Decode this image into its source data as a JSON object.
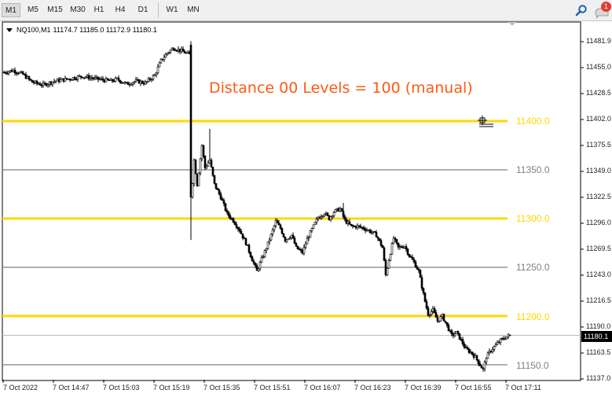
{
  "toolbar": {
    "timeframes": [
      "M1",
      "M5",
      "M15",
      "M30",
      "H1",
      "H4",
      "D1",
      "W1",
      "MN"
    ],
    "active_timeframe": "M1",
    "notification_count": "1"
  },
  "chart": {
    "symbol": "NQ100,M1",
    "ohlc": "11174.7 11185.0 11172.9 11180.1",
    "annotation": "Distance 00 Levels = 100 (manual)",
    "current_price": "11180.1",
    "price_labels": [
      "11481.9",
      "11455.0",
      "11428.5",
      "11402.0",
      "11375.5",
      "11349.0",
      "11322.5",
      "11296.0",
      "11269.5",
      "11243.0",
      "11216.5",
      "11190.0",
      "11163.5",
      "11137.0"
    ],
    "time_labels": [
      "7 Oct 2022",
      "7 Oct 14:47",
      "7 Oct 15:03",
      "7 Oct 15:19",
      "7 Oct 15:35",
      "7 Oct 15:51",
      "7 Oct 16:07",
      "7 Oct 16:23",
      "7 Oct 16:39",
      "7 Oct 16:55",
      "7 Oct 17:11"
    ],
    "levels": [
      {
        "label": "11400.0",
        "price": 11400,
        "color": "#ffd700"
      },
      {
        "label": "11350.0",
        "price": 11350,
        "color": "#808080"
      },
      {
        "label": "11300.0",
        "price": 11300,
        "color": "#ffd700"
      },
      {
        "label": "11250.0",
        "price": 11250,
        "color": "#808080"
      },
      {
        "label": "11200.0",
        "price": 11200,
        "color": "#ffd700"
      },
      {
        "label": "11150.0",
        "price": 11150,
        "color": "#808080"
      }
    ],
    "colors": {
      "major_level": "#ffd700",
      "minor_level": "#808080",
      "annotation": "#ff5a14",
      "candle": "#000000"
    }
  },
  "chart_data": {
    "type": "candlestick",
    "ylim": [
      11137,
      11490
    ],
    "close_path": [
      [
        0,
        11450
      ],
      [
        6,
        11452
      ],
      [
        12,
        11448
      ],
      [
        18,
        11440
      ],
      [
        25,
        11437
      ],
      [
        32,
        11441
      ],
      [
        40,
        11443
      ],
      [
        50,
        11446
      ],
      [
        60,
        11443
      ],
      [
        68,
        11441
      ],
      [
        72,
        11443
      ],
      [
        78,
        11438
      ],
      [
        84,
        11441
      ],
      [
        90,
        11439
      ],
      [
        96,
        11447
      ],
      [
        100,
        11462
      ],
      [
        104,
        11470
      ],
      [
        108,
        11475
      ],
      [
        113,
        11472
      ],
      [
        118,
        11468
      ],
      [
        118.5,
        11325
      ],
      [
        119,
        11315
      ],
      [
        121,
        11360
      ],
      [
        123,
        11335
      ],
      [
        126,
        11375
      ],
      [
        128,
        11352
      ],
      [
        131,
        11360
      ],
      [
        134,
        11335
      ],
      [
        138,
        11322
      ],
      [
        142,
        11305
      ],
      [
        146,
        11298
      ],
      [
        150,
        11288
      ],
      [
        154,
        11275
      ],
      [
        158,
        11258
      ],
      [
        161,
        11246
      ],
      [
        164,
        11258
      ],
      [
        167,
        11270
      ],
      [
        170,
        11283
      ],
      [
        173,
        11297
      ],
      [
        176,
        11290
      ],
      [
        179,
        11278
      ],
      [
        183,
        11283
      ],
      [
        186,
        11270
      ],
      [
        190,
        11265
      ],
      [
        193,
        11279
      ],
      [
        197,
        11292
      ],
      [
        200,
        11301
      ],
      [
        204,
        11306
      ],
      [
        207,
        11300
      ],
      [
        210,
        11307
      ],
      [
        214,
        11310
      ],
      [
        217,
        11298
      ],
      [
        221,
        11292
      ],
      [
        225,
        11292
      ],
      [
        229,
        11290
      ],
      [
        233,
        11287
      ],
      [
        237,
        11283
      ],
      [
        241,
        11270
      ],
      [
        243,
        11242
      ],
      [
        245,
        11258
      ],
      [
        248,
        11280
      ],
      [
        251,
        11270
      ],
      [
        255,
        11272
      ],
      [
        258,
        11262
      ],
      [
        261,
        11255
      ],
      [
        264,
        11246
      ],
      [
        266,
        11230
      ],
      [
        268,
        11215
      ],
      [
        270,
        11202
      ],
      [
        273,
        11206
      ],
      [
        276,
        11195
      ],
      [
        279,
        11200
      ],
      [
        282,
        11190
      ],
      [
        285,
        11180
      ],
      [
        288,
        11183
      ],
      [
        291,
        11175
      ],
      [
        294,
        11166
      ],
      [
        297,
        11163
      ],
      [
        300,
        11158
      ],
      [
        303,
        11150
      ],
      [
        305,
        11145
      ],
      [
        307,
        11158
      ],
      [
        310,
        11165
      ],
      [
        313,
        11170
      ],
      [
        316,
        11175
      ],
      [
        319,
        11178
      ],
      [
        322,
        11180.1
      ]
    ]
  }
}
